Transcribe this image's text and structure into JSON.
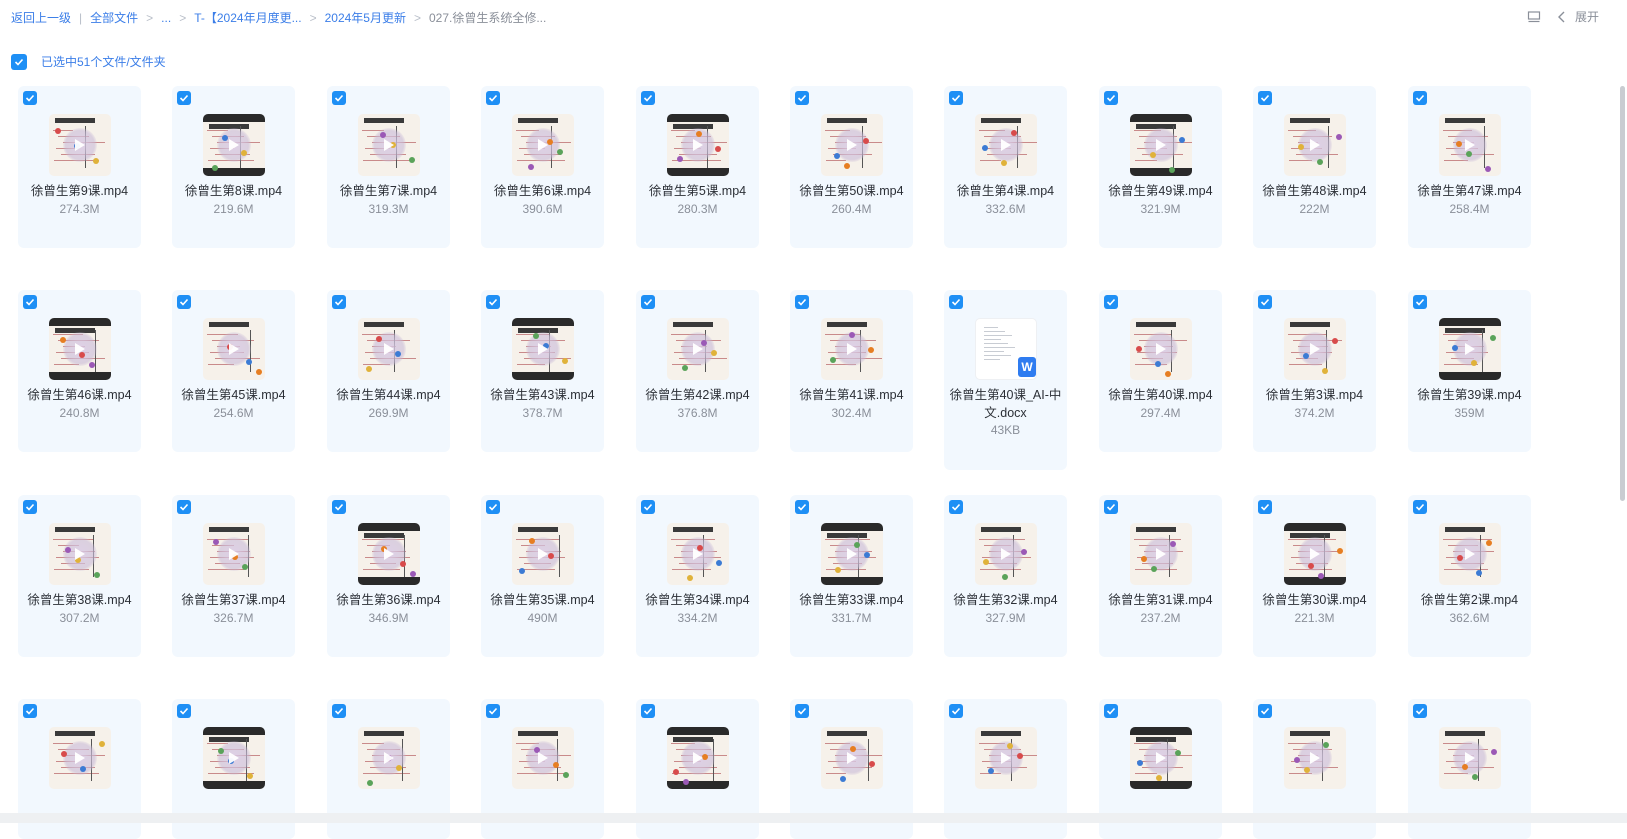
{
  "breadcrumb": {
    "back": "返回上一级",
    "all_files": "全部文件",
    "ellipsis": "...",
    "level1": "T-【2024年月度更...",
    "level2": "2024年5月更新",
    "current": "027.徐曾生系统全修..."
  },
  "toolbar": {
    "layout_icon": "layout-icon",
    "expand_label": "展开"
  },
  "selection": {
    "label": "已选中51个文件/文件夹"
  },
  "files": [
    {
      "name": "徐曾生第9课.mp4",
      "size": "274.3M",
      "type": "video"
    },
    {
      "name": "徐曾生第8课.mp4",
      "size": "219.6M",
      "type": "video"
    },
    {
      "name": "徐曾生第7课.mp4",
      "size": "319.3M",
      "type": "video"
    },
    {
      "name": "徐曾生第6课.mp4",
      "size": "390.6M",
      "type": "video"
    },
    {
      "name": "徐曾生第5课.mp4",
      "size": "280.3M",
      "type": "video"
    },
    {
      "name": "徐曾生第50课.mp4",
      "size": "260.4M",
      "type": "video"
    },
    {
      "name": "徐曾生第4课.mp4",
      "size": "332.6M",
      "type": "video"
    },
    {
      "name": "徐曾生第49课.mp4",
      "size": "321.9M",
      "type": "video"
    },
    {
      "name": "徐曾生第48课.mp4",
      "size": "222M",
      "type": "video"
    },
    {
      "name": "徐曾生第47课.mp4",
      "size": "258.4M",
      "type": "video"
    },
    {
      "name": "徐曾生第46课.mp4",
      "size": "240.8M",
      "type": "video"
    },
    {
      "name": "徐曾生第45课.mp4",
      "size": "254.6M",
      "type": "video"
    },
    {
      "name": "徐曾生第44课.mp4",
      "size": "269.9M",
      "type": "video"
    },
    {
      "name": "徐曾生第43课.mp4",
      "size": "378.7M",
      "type": "video"
    },
    {
      "name": "徐曾生第42课.mp4",
      "size": "376.8M",
      "type": "video"
    },
    {
      "name": "徐曾生第41课.mp4",
      "size": "302.4M",
      "type": "video"
    },
    {
      "name": "徐曾生第40课_AI-中文.docx",
      "size": "43KB",
      "type": "doc"
    },
    {
      "name": "徐曾生第40课.mp4",
      "size": "297.4M",
      "type": "video"
    },
    {
      "name": "徐曾生第3课.mp4",
      "size": "374.2M",
      "type": "video"
    },
    {
      "name": "徐曾生第39课.mp4",
      "size": "359M",
      "type": "video"
    },
    {
      "name": "徐曾生第38课.mp4",
      "size": "307.2M",
      "type": "video"
    },
    {
      "name": "徐曾生第37课.mp4",
      "size": "326.7M",
      "type": "video"
    },
    {
      "name": "徐曾生第36课.mp4",
      "size": "346.9M",
      "type": "video"
    },
    {
      "name": "徐曾生第35课.mp4",
      "size": "490M",
      "type": "video"
    },
    {
      "name": "徐曾生第34课.mp4",
      "size": "334.2M",
      "type": "video"
    },
    {
      "name": "徐曾生第33课.mp4",
      "size": "331.7M",
      "type": "video"
    },
    {
      "name": "徐曾生第32课.mp4",
      "size": "327.9M",
      "type": "video"
    },
    {
      "name": "徐曾生第31课.mp4",
      "size": "237.2M",
      "type": "video"
    },
    {
      "name": "徐曾生第30课.mp4",
      "size": "221.3M",
      "type": "video"
    },
    {
      "name": "徐曾生第2课.mp4",
      "size": "362.6M",
      "type": "video"
    },
    {
      "name": "",
      "size": "",
      "type": "video"
    },
    {
      "name": "",
      "size": "",
      "type": "video"
    },
    {
      "name": "",
      "size": "",
      "type": "video"
    },
    {
      "name": "",
      "size": "",
      "type": "video"
    },
    {
      "name": "",
      "size": "",
      "type": "video"
    },
    {
      "name": "",
      "size": "",
      "type": "video"
    },
    {
      "name": "",
      "size": "",
      "type": "video"
    },
    {
      "name": "",
      "size": "",
      "type": "video"
    },
    {
      "name": "",
      "size": "",
      "type": "video"
    },
    {
      "name": "",
      "size": "",
      "type": "video"
    }
  ],
  "colors": {
    "accent": "#1e8ff5",
    "link": "#3b7ee8",
    "card_bg": "#f2f8fe"
  }
}
